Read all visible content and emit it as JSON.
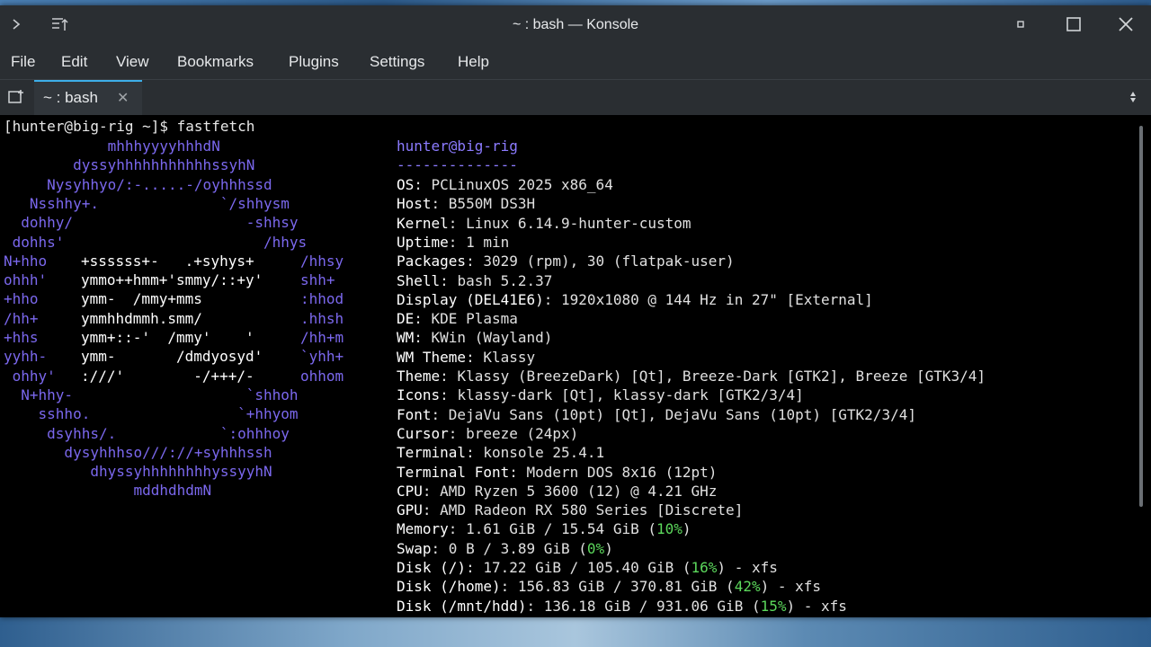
{
  "window": {
    "title": "~ : bash — Konsole"
  },
  "menu": [
    "File",
    "Edit",
    "View",
    "Bookmarks",
    "Plugins",
    "Settings",
    "Help"
  ],
  "tab": {
    "label": "~ : bash"
  },
  "prompt": "[hunter@big-rig ~]$ fastfetch",
  "logo": [
    "            mhhhyyyyhhhdN",
    "        dyssyhhhhhhhhhhhssyhN",
    "     Nysyhhyo/:-.....-/oyhhhssd",
    "   Nsshhy+.              `/shhysm",
    "  dohhy/                    -shhsy",
    " dohhs'                       /hhys",
    "N+hho",
    "ohhh'",
    "+hho",
    "/hh+",
    "+hhs",
    "yyhh-",
    " ohhy'",
    "  N+hhy-                    `shhoh",
    "    sshho.                 `+hhyom",
    "     dsyhhs/.            `:ohhhoy",
    "       dysyhhhso///://+syhhhssh",
    "          dhyssyhhhhhhhhyssyyhN",
    "               mddhdhdmN"
  ],
  "logo_mid": [
    {
      "left": "+ssssss+-   .+syhys+",
      "right": "/hhsy"
    },
    {
      "left": "ymmo++hmm+'smmy/::+y'",
      "right": "shh+"
    },
    {
      "left": "ymm-  /mmy+mms",
      "right": ":hhod"
    },
    {
      "left": "ymmhhdmmh.smm/",
      "right": ".hhsh"
    },
    {
      "left": "ymm+::-'  /mmy'    '",
      "right": "/hh+m"
    },
    {
      "left": "ymm-       /dmdyosyd'",
      "right": "`yhh+"
    },
    {
      "left": ":///'        -/+++/-",
      "right": "ohhom"
    }
  ],
  "user_host": "hunter@big-rig",
  "separator": "--------------",
  "info": [
    {
      "label": "OS",
      "value": "PCLinuxOS 2025 x86_64"
    },
    {
      "label": "Host",
      "value": "B550M DS3H"
    },
    {
      "label": "Kernel",
      "value": "Linux 6.14.9-hunter-custom"
    },
    {
      "label": "Uptime",
      "value": "1 min"
    },
    {
      "label": "Packages",
      "value": "3029 (rpm), 30 (flatpak-user)"
    },
    {
      "label": "Shell",
      "value": "bash 5.2.37"
    },
    {
      "label": "Display (DEL41E6)",
      "value": "1920x1080 @ 144 Hz in 27\" [External]"
    },
    {
      "label": "DE",
      "value": "KDE Plasma"
    },
    {
      "label": "WM",
      "value": "KWin (Wayland)"
    },
    {
      "label": "WM Theme",
      "value": "Klassy"
    },
    {
      "label": "Theme",
      "value": "Klassy (BreezeDark) [Qt], Breeze-Dark [GTK2], Breeze [GTK3/4]"
    },
    {
      "label": "Icons",
      "value": "klassy-dark [Qt], klassy-dark [GTK2/3/4]"
    },
    {
      "label": "Font",
      "value": "DejaVu Sans (10pt) [Qt], DejaVu Sans (10pt) [GTK2/3/4]"
    },
    {
      "label": "Cursor",
      "value": "breeze (24px)"
    },
    {
      "label": "Terminal",
      "value": "konsole 25.4.1"
    },
    {
      "label": "Terminal Font",
      "value": "Modern DOS 8x16 (12pt)"
    },
    {
      "label": "CPU",
      "value": "AMD Ryzen 5 3600 (12) @ 4.21 GHz"
    },
    {
      "label": "GPU",
      "value": "AMD Radeon RX 580 Series [Discrete]"
    }
  ],
  "usage": [
    {
      "label": "Memory",
      "pre": "1.61 GiB / 15.54 GiB (",
      "pct": "10%",
      "post": ")"
    },
    {
      "label": "Swap",
      "pre": "0 B / 3.89 GiB (",
      "pct": "0%",
      "post": ")"
    },
    {
      "label": "Disk (/)",
      "pre": "17.22 GiB / 105.40 GiB (",
      "pct": "16%",
      "post": ") - xfs"
    },
    {
      "label": "Disk (/home)",
      "pre": "156.83 GiB / 370.81 GiB (",
      "pct": "42%",
      "post": ") - xfs"
    },
    {
      "label": "Disk (/mnt/hdd)",
      "pre": "136.18 GiB / 931.06 GiB (",
      "pct": "15%",
      "post": ") - xfs"
    }
  ],
  "colors": {
    "accent": "#3daee9",
    "logo": "#7b68ee",
    "highlight": "#5cd85c"
  }
}
